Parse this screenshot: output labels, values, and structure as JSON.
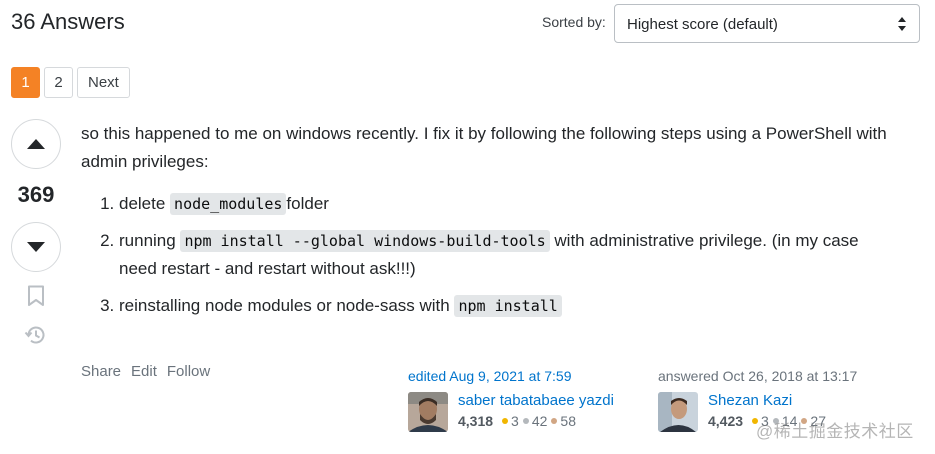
{
  "header": {
    "answers_count": "36 Answers",
    "sort_label": "Sorted by:",
    "sort_value": "Highest score (default)"
  },
  "pagination": {
    "pages": [
      "1",
      "2"
    ],
    "current": "1",
    "next_label": "Next"
  },
  "vote": {
    "score": "369"
  },
  "post": {
    "intro": "so this happened to me on windows recently. I fix it by following the following steps using a PowerShell with admin privileges:",
    "steps": [
      {
        "before": "delete ",
        "code": "node_modules",
        "after": "folder"
      },
      {
        "before": "running ",
        "code": "npm install --global windows-build-tools",
        "after": " with administrative privilege. (in my case need restart - and restart without ask!!!)"
      },
      {
        "before": "reinstalling node modules or node-sass with ",
        "code": "npm install",
        "after": ""
      }
    ]
  },
  "post_menu": {
    "share": "Share",
    "edit": "Edit",
    "follow": "Follow"
  },
  "edited": {
    "time": "edited Aug 9, 2021 at 7:59",
    "user_name": "saber tabatabaee yazdi",
    "reputation": "4,318",
    "gold": "3",
    "silver": "42",
    "bronze": "58"
  },
  "answered": {
    "time": "answered Oct 26, 2018 at 13:17",
    "user_name": "Shezan Kazi",
    "reputation": "4,423",
    "gold": "3",
    "silver": "14",
    "bronze": "27"
  },
  "watermark": "@稀土掘金技术社区",
  "colors": {
    "accent": "#f48225",
    "link": "#0074cc",
    "code_bg": "#e3e6e8",
    "gold_badge": "#f1b600",
    "silver_badge": "#b4b8bc",
    "bronze_badge": "#d1a684"
  }
}
